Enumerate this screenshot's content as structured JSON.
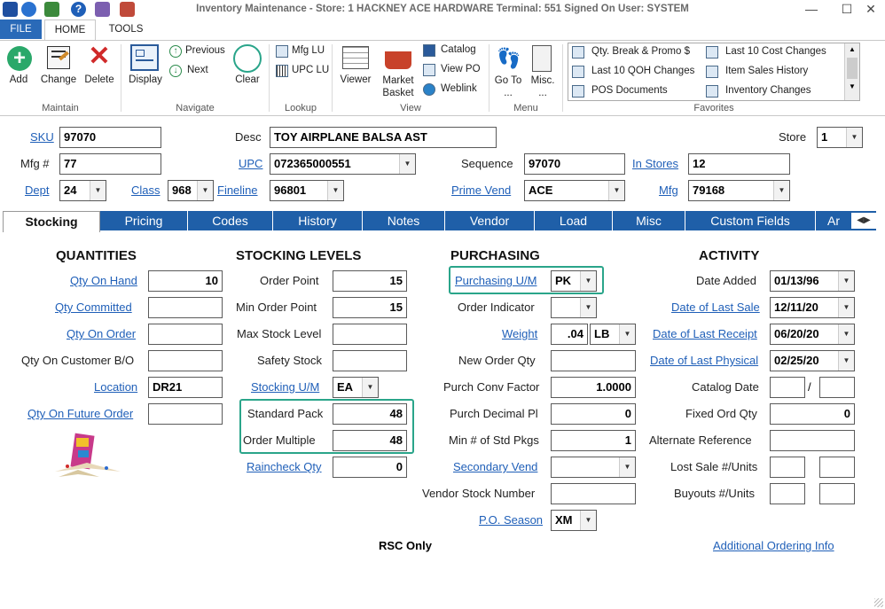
{
  "window": {
    "title": "Inventory Maintenance - Store: 1 HACKNEY ACE HARDWARE Terminal: 551 Signed On User: SYSTEM"
  },
  "menu": {
    "file": "FILE",
    "home": "HOME",
    "tools": "TOOLS"
  },
  "ribbon": {
    "maintain": {
      "label": "Maintain",
      "add": "Add",
      "change": "Change",
      "delete": "Delete"
    },
    "navigate": {
      "label": "Navigate",
      "display": "Display",
      "previous": "Previous",
      "next": "Next",
      "clear": "Clear"
    },
    "lookup": {
      "label": "Lookup",
      "mfg_lu": "Mfg LU",
      "upc_lu": "UPC LU"
    },
    "view": {
      "label": "View",
      "viewer": "Viewer",
      "market_basket_1": "Market",
      "market_basket_2": "Basket",
      "catalog": "Catalog",
      "view_po": "View PO",
      "weblink": "Weblink"
    },
    "menu": {
      "label": "Menu",
      "goto_1": "Go To",
      "goto_2": "...",
      "misc_1": "Misc.",
      "misc_2": "..."
    },
    "favorites": {
      "label": "Favorites",
      "items": [
        "Qty. Break & Promo $",
        "Last 10 Cost Changes",
        "Last 10 QOH Changes",
        "Item Sales History",
        "POS Documents",
        "Inventory Changes"
      ]
    }
  },
  "header": {
    "sku_label": "SKU",
    "sku": "97070",
    "desc_label": "Desc",
    "desc": "TOY AIRPLANE BALSA AST",
    "store_label": "Store",
    "store": "1",
    "mfg_label": "Mfg #",
    "mfg": "77",
    "upc_label": "UPC",
    "upc": "072365000551",
    "sequence_label": "Sequence",
    "sequence": "97070",
    "instores_label": "In Stores",
    "instores": "12",
    "dept_label": "Dept",
    "dept": "24",
    "class_label": "Class",
    "class": "968",
    "fineline_label": "Fineline",
    "fineline": "96801",
    "primevend_label": "Prime Vend",
    "primevend": "ACE",
    "mfgc_label": "Mfg",
    "mfgc": "79168"
  },
  "tabs": [
    "Stocking",
    "Pricing",
    "Codes",
    "History",
    "Notes",
    "Vendor",
    "Load",
    "Misc",
    "Custom Fields",
    "Ar"
  ],
  "quantities": {
    "title": "QUANTITIES",
    "qoh_label": "Qty On Hand",
    "qoh": "10",
    "committed_label": "Qty Committed",
    "committed": "",
    "onorder_label": "Qty On Order",
    "onorder": "",
    "custbo_label": "Qty On Customer B/O",
    "custbo": "",
    "location_label": "Location",
    "location": "DR21",
    "future_label": "Qty On Future Order",
    "future": ""
  },
  "stocking": {
    "title": "STOCKING LEVELS",
    "orderpoint_label": "Order Point",
    "orderpoint": "15",
    "minorder_label": "Min Order Point",
    "minorder": "15",
    "maxstock_label": "Max Stock Level",
    "maxstock": "",
    "safety_label": "Safety Stock",
    "safety": "",
    "um_label": "Stocking U/M",
    "um": "EA",
    "stdpack_label": "Standard Pack",
    "stdpack": "48",
    "ordmult_label": "Order Multiple",
    "ordmult": "48",
    "raincheck_label": "Raincheck Qty",
    "raincheck": "0"
  },
  "purchasing": {
    "title": "PURCHASING",
    "pum_label": "Purchasing U/M",
    "pum": "PK",
    "ordind_label": "Order Indicator",
    "ordind": "",
    "weight_label": "Weight",
    "weight": ".04",
    "weight_unit": "LB",
    "newordqty_label": "New Order Qty",
    "newordqty": "",
    "conv_label": "Purch Conv Factor",
    "conv": "1.0000",
    "decpl_label": "Purch Decimal Pl",
    "decpl": "0",
    "minstd_label": "Min # of Std Pkgs",
    "minstd": "1",
    "secvend_label": "Secondary Vend",
    "secvend": "",
    "vendstock_label": "Vendor Stock Number",
    "vendstock": "",
    "poseason_label": "P.O. Season",
    "poseason": "XM",
    "rsc": "RSC Only"
  },
  "activity": {
    "title": "ACTIVITY",
    "added_label": "Date Added",
    "added": "01/13/96",
    "lastsale_label": "Date of Last Sale",
    "lastsale": "12/11/20",
    "lastreceipt_label": "Date of Last Receipt",
    "lastreceipt": "06/20/20",
    "lastphys_label": "Date of Last Physical",
    "lastphys": "02/25/20",
    "catalog_label": "Catalog Date",
    "catalog_sep": "/",
    "fixedord_label": "Fixed Ord Qty",
    "fixedord": "0",
    "altref_label": "Alternate Reference",
    "altref": "",
    "lostsale_label": "Lost Sale #/Units",
    "buyouts_label": "Buyouts #/Units",
    "addl_link": "Additional Ordering Info"
  }
}
